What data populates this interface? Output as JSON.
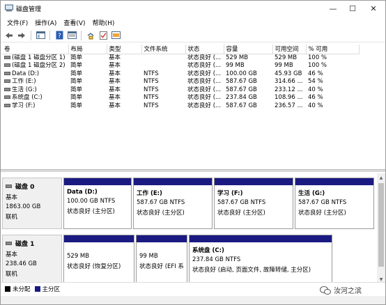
{
  "window": {
    "title": "磁盘管理",
    "minimize": "—",
    "maximize": "☐",
    "close": "✕"
  },
  "menu": [
    {
      "label": "文件(F)"
    },
    {
      "label": "操作(A)"
    },
    {
      "label": "查看(V)"
    },
    {
      "label": "帮助(H)"
    }
  ],
  "toolbar": {
    "icons": [
      "back-icon",
      "forward-icon",
      "console-tree-icon",
      "help-icon",
      "properties-icon",
      "connect-icon",
      "checklist-icon",
      "disk-icon"
    ]
  },
  "table": {
    "columns": [
      "卷",
      "布局",
      "类型",
      "文件系统",
      "状态",
      "容量",
      "可用空间",
      "% 可用"
    ],
    "rows": [
      [
        "(磁盘 1 磁盘分区 1)",
        "简单",
        "基本",
        "",
        "状态良好 (...",
        "529 MB",
        "529 MB",
        "100 %"
      ],
      [
        "(磁盘 1 磁盘分区 2)",
        "简单",
        "基本",
        "",
        "状态良好 (...",
        "99 MB",
        "99 MB",
        "100 %"
      ],
      [
        "Data (D:)",
        "简单",
        "基本",
        "NTFS",
        "状态良好 (...",
        "100.00 GB",
        "45.93 GB",
        "46 %"
      ],
      [
        "工作 (E:)",
        "简单",
        "基本",
        "NTFS",
        "状态良好 (...",
        "587.67 GB",
        "314.66 ...",
        "54 %"
      ],
      [
        "生活 (G:)",
        "简单",
        "基本",
        "NTFS",
        "状态良好 (...",
        "587.67 GB",
        "233.12 ...",
        "40 %"
      ],
      [
        "系统盘 (C:)",
        "简单",
        "基本",
        "NTFS",
        "状态良好 (...",
        "237.84 GB",
        "108.96 ...",
        "46 %"
      ],
      [
        "学习 (F:)",
        "简单",
        "基本",
        "NTFS",
        "状态良好 (...",
        "587.67 GB",
        "236.57 ...",
        "40 %"
      ]
    ]
  },
  "disks": [
    {
      "name": "磁盘 0",
      "type": "基本",
      "size": "1863.00 GB",
      "status": "联机",
      "partitions": [
        {
          "name": "Data  (D:)",
          "size": "100.00 GB NTFS",
          "status": "状态良好 (主分区)"
        },
        {
          "name": "工作  (E:)",
          "size": "587.67 GB NTFS",
          "status": "状态良好 (主分区)"
        },
        {
          "name": "学习  (F:)",
          "size": "587.67 GB NTFS",
          "status": "状态良好 (主分区)"
        },
        {
          "name": "生活  (G:)",
          "size": "587.67 GB NTFS",
          "status": "状态良好 (主分区)"
        }
      ]
    },
    {
      "name": "磁盘 1",
      "type": "基本",
      "size": "238.46 GB",
      "status": "联机",
      "partitions": [
        {
          "name": "",
          "size": "529 MB",
          "status": "状态良好 (恢复分区)"
        },
        {
          "name": "",
          "size": "99 MB",
          "status": "状态良好 (EFI 系"
        },
        {
          "name": "系统盘  (C:)",
          "size": "237.84 GB NTFS",
          "status": "状态良好 (启动, 页面文件, 故障转储, 主分区)"
        }
      ]
    }
  ],
  "legend": [
    {
      "label": "未分配",
      "color": "#000000"
    },
    {
      "label": "主分区",
      "color": "#1a1a82"
    }
  ],
  "watermark": {
    "text": "汝河之滨"
  }
}
